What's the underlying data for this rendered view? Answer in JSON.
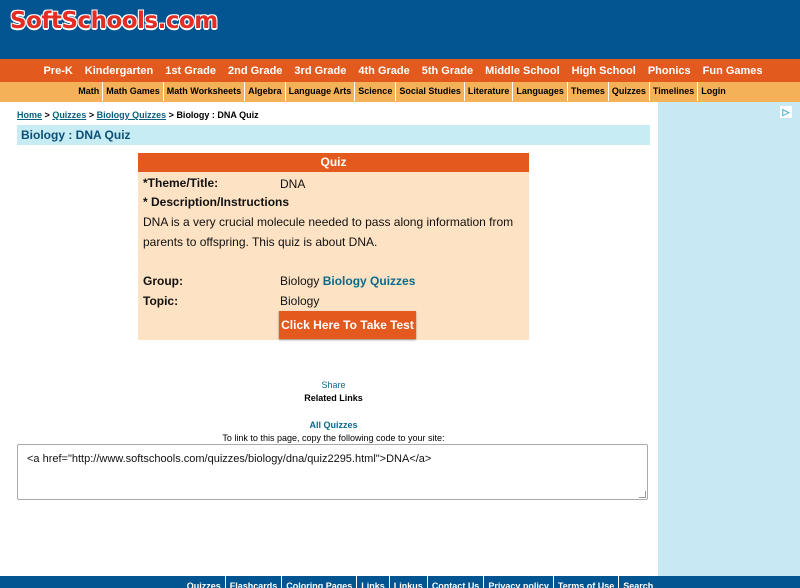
{
  "header": {
    "logo_text": "SoftSchools.com",
    "logo_parts": [
      "Soft",
      "Schools",
      ".com"
    ]
  },
  "nav_primary": [
    "Pre-K",
    "Kindergarten",
    "1st Grade",
    "2nd Grade",
    "3rd Grade",
    "4th Grade",
    "5th Grade",
    "Middle School",
    "High School",
    "Phonics",
    "Fun Games"
  ],
  "nav_secondary": [
    "Math",
    "Math Games",
    "Math Worksheets",
    "Algebra",
    "Language Arts",
    "Science",
    "Social Studies",
    "Literature",
    "Languages",
    "Themes",
    "Quizzes",
    "Timelines",
    "Login"
  ],
  "breadcrumb": {
    "home": "Home",
    "sep": ">",
    "quizzes": "Quizzes",
    "biology_quizzes": "Biology Quizzes",
    "current": "Biology : DNA Quiz"
  },
  "page_title": "Biology : DNA Quiz",
  "quiz": {
    "header": "Quiz",
    "theme_label": "*Theme/Title:",
    "theme_value": "DNA",
    "desc_label": "* Description/Instructions",
    "description": "DNA is a very crucial molecule needed to pass along information from parents to offspring. This quiz is about DNA.",
    "group_label": "Group:",
    "group_value": "Biology",
    "group_link": "Biology Quizzes",
    "topic_label": "Topic:",
    "topic_value": "Biology",
    "take_button": "Click Here To Take Test"
  },
  "share_label": "Share",
  "related_label": "Related Links",
  "all_quizzes_label": "All Quizzes",
  "link_hint": "To link to this page, copy the following code to your site:",
  "embed_code": "<a href=\"http://www.softschools.com/quizzes/biology/dna/quiz2295.html\">DNA</a>",
  "ad": {
    "icon": "adchoices-icon",
    "icon_glyph": "▷"
  },
  "footer_links": [
    "Quizzes",
    "Flashcards",
    "Coloring Pages",
    "Links",
    "Linkus",
    "Contact Us",
    "Privacy policy",
    "Terms of Use",
    "Search"
  ],
  "colors": {
    "header_blue": "#035591",
    "nav_orange": "#e35a1e",
    "subnav_orange": "#f4b157",
    "quiz_bg": "#fde2c4",
    "title_bg": "#c8ecf4",
    "link_teal": "#0a6a8c"
  }
}
